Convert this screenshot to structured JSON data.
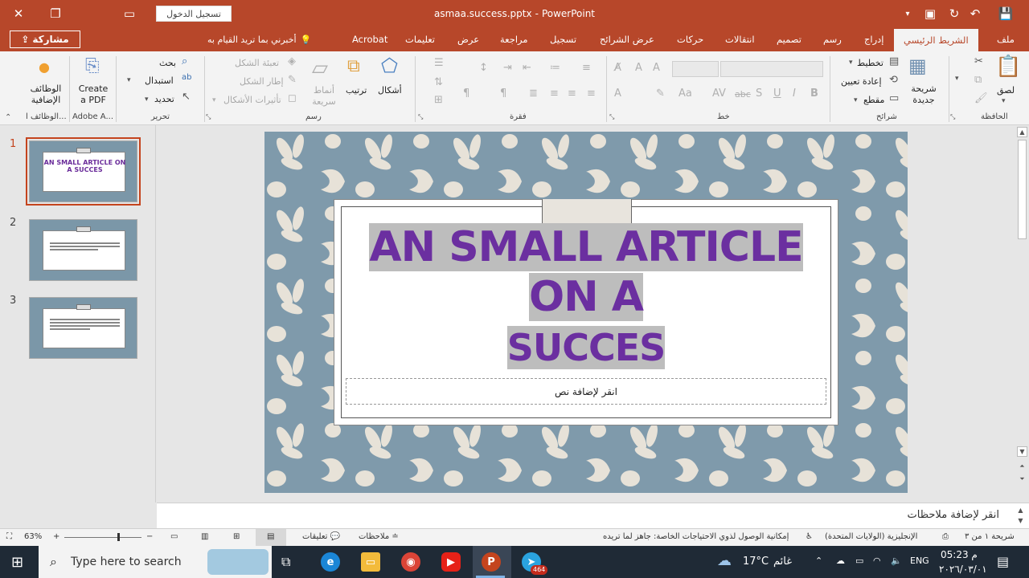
{
  "titlebar": {
    "signin_label": "تسجيل الدخول",
    "doc_name": "asmaa.success.pptx",
    "separator": "-",
    "app_name": "PowerPoint",
    "accent_color": "#b7472a"
  },
  "tabs": {
    "share_label": "مشاركة",
    "tellme_label": "أخبرني بما تريد القيام به",
    "items": [
      "Acrobat",
      "تعليمات",
      "عرض",
      "مراجعة",
      "تسجيل",
      "عرض الشرائح",
      "حركات",
      "انتقالات",
      "تصميم",
      "رسم",
      "إدراج",
      "الشريط الرئيسي",
      "ملف"
    ],
    "active": "الشريط الرئيسي"
  },
  "ribbon": {
    "addins": {
      "label": "الوظائف الإضافية",
      "group": "الوظائف ا..."
    },
    "adobe": {
      "label": "Create a PDF",
      "group": "Adobe A..."
    },
    "editing": {
      "find": "بحث",
      "replace": "استبدال",
      "select": "تحديد",
      "group": "تحرير"
    },
    "drawing": {
      "fill": "تعبئة الشكل",
      "outline": "إطار الشكل",
      "effects": "تأثيرات الأشكال",
      "styles": "أنماط سريعة",
      "arrange": "ترتيب",
      "shapes": "أشكال",
      "group": "رسم"
    },
    "paragraph": {
      "group": "فقرة"
    },
    "font": {
      "group": "خط",
      "bold": "B",
      "italic": "I",
      "underline": "U",
      "strike": "abc"
    },
    "slides": {
      "layout": "تخطيط",
      "reset": "إعادة تعيين",
      "section": "مقطع",
      "new_slide": "شريحة جديدة",
      "group": "شرائح"
    },
    "clipboard": {
      "paste": "لصق",
      "group": "الحافظة"
    }
  },
  "thumbnails": [
    {
      "num": "1",
      "title": "AN SMALL ARTICLE ON A SUCCES",
      "selected": true
    },
    {
      "num": "2",
      "title": "",
      "selected": false
    },
    {
      "num": "3",
      "title": "",
      "selected": false
    }
  ],
  "slide": {
    "title_line1": "AN SMALL ARTICLE ON A",
    "title_line2": "SUCCES",
    "body_placeholder": "انقر لإضافة نص",
    "title_color": "#6b2fa0"
  },
  "notes": {
    "placeholder": "انقر لإضافة ملاحظات"
  },
  "status": {
    "slide_info": "شريحة ١ من ٣",
    "language": "الإنجليزية (الولايات المتحدة)",
    "accessibility": "إمكانية الوصول لذوي الاحتياجات الخاصة: جاهز لما تريده",
    "notes_btn": "ملاحظات",
    "comments_btn": "تعليقات",
    "zoom": "63%"
  },
  "taskbar": {
    "search_placeholder": "Type here to search",
    "weather_temp": "17°C",
    "weather_text": "غائم",
    "lang": "ENG",
    "time": "05:23 م",
    "date": "٢٠٢٦/٠٣/٠١",
    "telegram_badge": "464"
  }
}
